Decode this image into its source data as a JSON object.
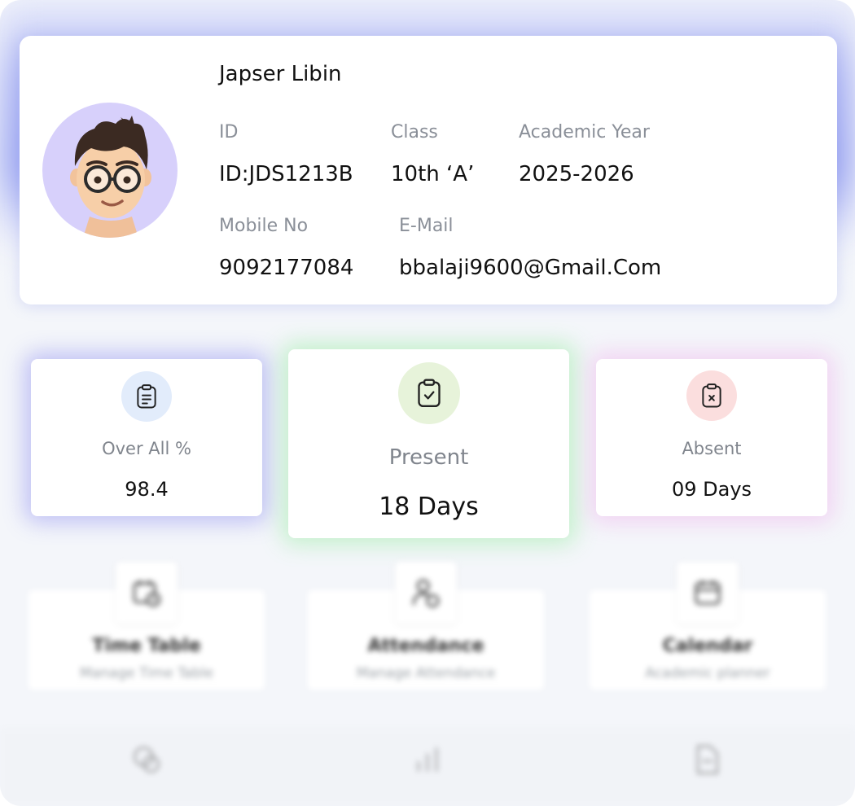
{
  "profile": {
    "name": "Japser Libin",
    "id_label": "ID",
    "id_value": "ID:JDS1213B",
    "class_label": "Class",
    "class_value": "10th ‘A’",
    "year_label": "Academic Year",
    "year_value": "2025-2026",
    "mobile_label": "Mobile No",
    "mobile_value": "9092177084",
    "email_label": "E-Mail",
    "email_value": "bbalaji9600@Gmail.Com"
  },
  "stats": [
    {
      "label": "Over All %",
      "value": "98.4",
      "icon": "clipboard-list-icon",
      "accent": "#e2ecfb"
    },
    {
      "label": "Present",
      "value": "18 Days",
      "icon": "clipboard-check-icon",
      "accent": "#e7f3da"
    },
    {
      "label": "Absent",
      "value": "09 Days",
      "icon": "clipboard-x-icon",
      "accent": "#fbdede"
    }
  ],
  "menu": [
    {
      "title": "Time Table",
      "subtitle": "Manage Time Table",
      "icon": "calendar-clock-icon"
    },
    {
      "title": "Attendance",
      "subtitle": "Manage Attendance",
      "icon": "user-check-icon"
    },
    {
      "title": "Calendar",
      "subtitle": "Academic planner",
      "icon": "calendar-icon"
    }
  ],
  "row2_icons": [
    "chat-icon",
    "chart-icon",
    "document-icon"
  ]
}
